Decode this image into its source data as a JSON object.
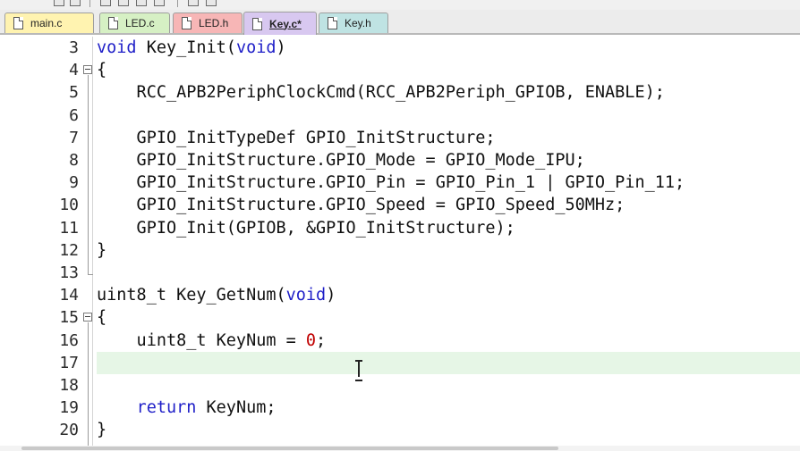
{
  "tabs": [
    {
      "label": "main.c",
      "color": "#fff3b0",
      "active": false
    },
    {
      "label": "LED.c",
      "color": "#d6f0c4",
      "active": false
    },
    {
      "label": "LED.h",
      "color": "#f7b6b6",
      "active": false
    },
    {
      "label": "Key.c*",
      "color": "#d8c8f0",
      "active": true
    },
    {
      "label": "Key.h",
      "color": "#bfe3e3",
      "active": false
    }
  ],
  "editor": {
    "current_line": "17",
    "lines": [
      {
        "num": "3",
        "code": "void Key_Init(void)"
      },
      {
        "num": "4",
        "code": "{"
      },
      {
        "num": "5",
        "code": "    RCC_APB2PeriphClockCmd(RCC_APB2Periph_GPIOB, ENABLE);"
      },
      {
        "num": "6",
        "code": ""
      },
      {
        "num": "7",
        "code": "    GPIO_InitTypeDef GPIO_InitStructure;"
      },
      {
        "num": "8",
        "code": "    GPIO_InitStructure.GPIO_Mode = GPIO_Mode_IPU;"
      },
      {
        "num": "9",
        "code": "    GPIO_InitStructure.GPIO_Pin = GPIO_Pin_1 | GPIO_Pin_11;"
      },
      {
        "num": "10",
        "code": "    GPIO_InitStructure.GPIO_Speed = GPIO_Speed_50MHz;"
      },
      {
        "num": "11",
        "code": "    GPIO_Init(GPIOB, &GPIO_InitStructure);"
      },
      {
        "num": "12",
        "code": "}"
      },
      {
        "num": "13",
        "code": ""
      },
      {
        "num": "14",
        "code": "uint8_t Key_GetNum(void)"
      },
      {
        "num": "15",
        "code": "{"
      },
      {
        "num": "16",
        "code": "    uint8_t KeyNum = 0;"
      },
      {
        "num": "17",
        "code": ""
      },
      {
        "num": "18",
        "code": ""
      },
      {
        "num": "19",
        "code": "    return KeyNum;"
      },
      {
        "num": "20",
        "code": "}"
      }
    ]
  },
  "icons": {
    "file": "file-icon",
    "fold": "fold-collapse-icon",
    "cursor": "text-cursor-icon"
  },
  "colors": {
    "keyword": "#1f1fc8",
    "number": "#c00000",
    "current_line_bg": "#e6f6e6"
  }
}
